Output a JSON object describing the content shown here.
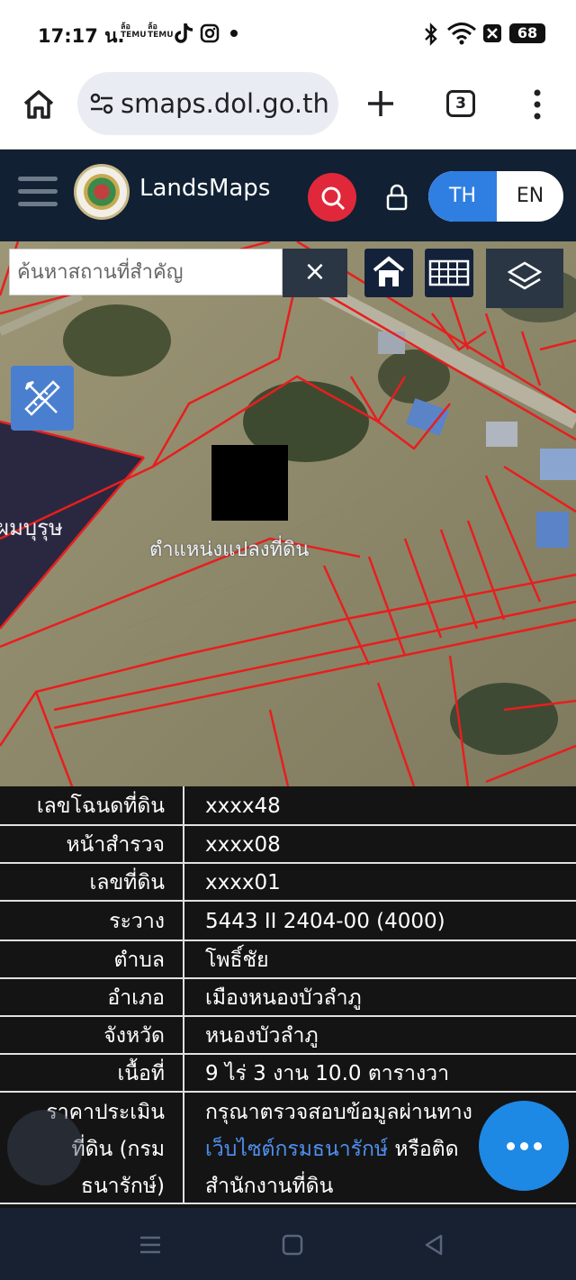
{
  "status_bar": {
    "time": "17:17 น.",
    "notif_app1": "ข้อมูล TEMU",
    "notif_app2": "ข้อมูล TEMU",
    "battery": "68",
    "icons": [
      "temu-icon",
      "temu-icon",
      "tiktok-icon",
      "instagram-icon",
      "dot-icon",
      "bluetooth-icon",
      "wifi-icon",
      "close-box-icon",
      "battery-icon"
    ]
  },
  "browser": {
    "url": "smaps.dol.go.th",
    "tab_count": "3"
  },
  "header": {
    "brand": "LandsMaps",
    "lang_th": "TH",
    "lang_en": "EN"
  },
  "map": {
    "search_placeholder": "ค้นหาสถานที่สำคัญ",
    "clear_label": "×",
    "parcel_label": "ตำแหน่งแปลงที่ดิน",
    "area_label": "ผมบุรุษ"
  },
  "info": {
    "rows": [
      {
        "label": "เลขโฉนดที่ดิน",
        "value": "xxxx48"
      },
      {
        "label": "หน้าสำรวจ",
        "value": "xxxx08"
      },
      {
        "label": "เลขที่ดิน",
        "value": "xxxx01"
      },
      {
        "label": "ระวาง",
        "value": "5443 II 2404-00 (4000)"
      },
      {
        "label": "ตำบล",
        "value": "โพธิ์ชัย"
      },
      {
        "label": "อำเภอ",
        "value": "เมืองหนองบัวลำภู"
      },
      {
        "label": "จังหวัด",
        "value": "หนองบัวลำภู"
      },
      {
        "label": "เนื้อที่",
        "value": "9 ไร่ 3 งาน 10.0 ตารางวา"
      }
    ],
    "price": {
      "label_line1": "ราคาประเมิน",
      "label_line2": "ที่ดิน (กรม",
      "label_line3": "ธนารักษ์)",
      "value_line1": "กรุณาตรวจสอบข้อมูลผ่านทาง",
      "value_link": "เว็บไซต์กรมธนารักษ์",
      "value_line2_rest": " หรือติด",
      "value_line3": "สำนักงานที่ดิน"
    }
  },
  "colors": {
    "header_bg": "#112033",
    "accent_blue": "#2f7fe3",
    "search_red": "#e0283a",
    "parcel_red": "#e81e1e",
    "link_blue": "#4f8ff0"
  }
}
